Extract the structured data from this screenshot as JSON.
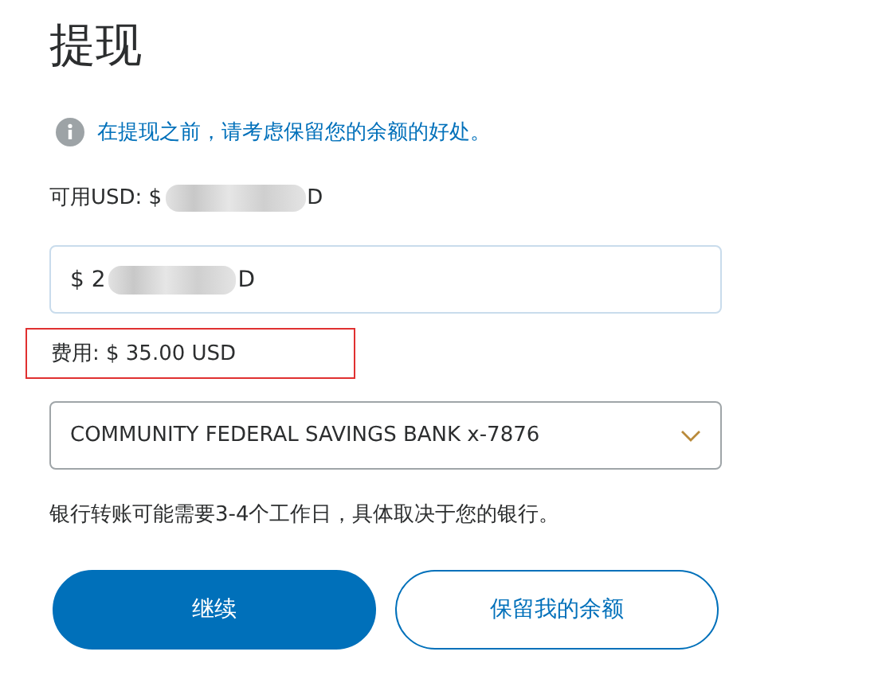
{
  "title": "提现",
  "info": {
    "text": "在提现之前，请考虑保留您的余额的好处。"
  },
  "available": {
    "before": "可用USD: $",
    "after": "D",
    "redacted": true
  },
  "amount_field": {
    "before": "$ 2",
    "after": "D",
    "redacted": true
  },
  "fee": {
    "text": "费用: $ 35.00 USD",
    "highlighted": true
  },
  "bank_select": {
    "value": "COMMUNITY FEDERAL SAVINGS BANK x-7876"
  },
  "note": "银行转账可能需要3-4个工作日，具体取决于您的银行。",
  "buttons": [
    {
      "label": "继续",
      "kind": "primary"
    },
    {
      "label": "保留我的余额",
      "kind": "secondary"
    }
  ]
}
